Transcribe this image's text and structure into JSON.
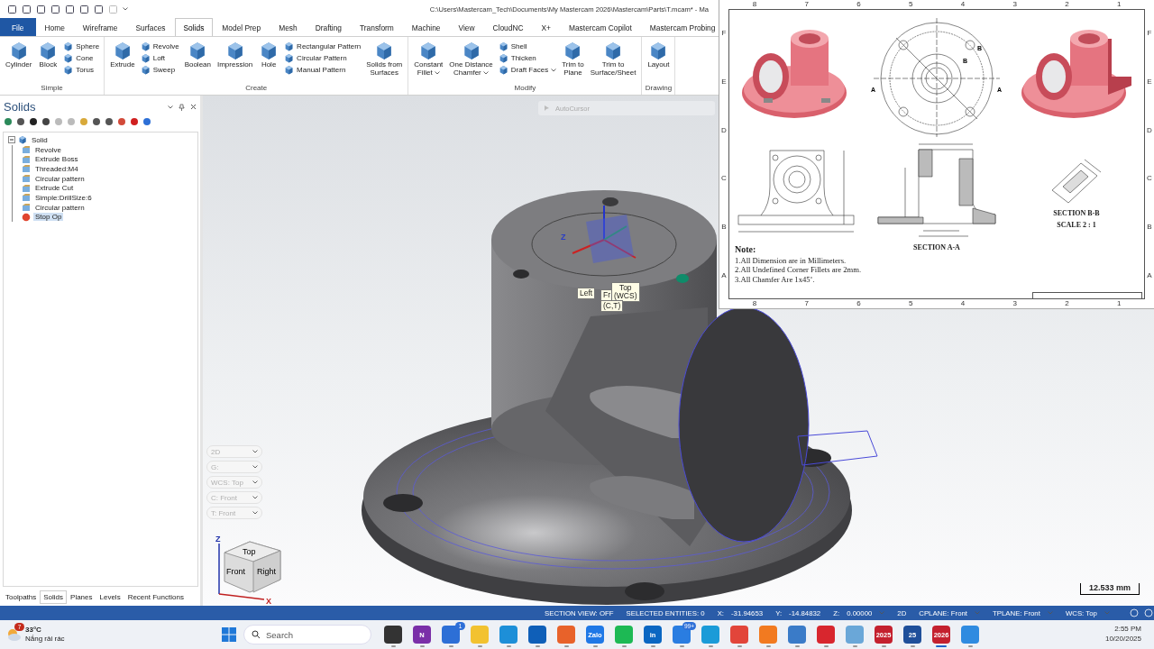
{
  "title_bar": {
    "path": "C:\\Users\\Mastercam_Tech\\Documents\\My Mastercam 2026\\Mastercam\\Parts\\T.mcam* - Ma"
  },
  "ribbon_tabs": [
    {
      "label": "File",
      "kind": "file",
      "selected": false
    },
    {
      "label": "Home",
      "kind": "tab",
      "selected": false
    },
    {
      "label": "Wireframe",
      "kind": "tab",
      "selected": false
    },
    {
      "label": "Surfaces",
      "kind": "tab",
      "selected": false
    },
    {
      "label": "Solids",
      "kind": "tab",
      "selected": true
    },
    {
      "label": "Model Prep",
      "kind": "tab",
      "selected": false
    },
    {
      "label": "Mesh",
      "kind": "tab",
      "selected": false
    },
    {
      "label": "Drafting",
      "kind": "tab",
      "selected": false
    },
    {
      "label": "Transform",
      "kind": "tab",
      "selected": false
    },
    {
      "label": "Machine",
      "kind": "tab",
      "selected": false
    },
    {
      "label": "View",
      "kind": "tab",
      "selected": false
    },
    {
      "label": "CloudNC",
      "kind": "tab",
      "selected": false
    },
    {
      "label": "X+",
      "kind": "tab",
      "selected": false
    },
    {
      "label": "Mastercam Copilot",
      "kind": "tab",
      "selected": false
    },
    {
      "label": "Mastercam Probing",
      "kind": "tab",
      "selected": false
    }
  ],
  "ribbon_groups": [
    {
      "label": "Simple",
      "items": [
        {
          "label": "Cylinder",
          "kind": "large",
          "dropdown": false
        },
        {
          "label": "Block",
          "kind": "large",
          "dropdown": false
        },
        {
          "label": "Sphere",
          "kind": "small",
          "dropdown": false
        },
        {
          "label": "Cone",
          "kind": "small",
          "dropdown": false
        },
        {
          "label": "Torus",
          "kind": "small",
          "dropdown": false
        }
      ]
    },
    {
      "label": "Create",
      "items": [
        {
          "label": "Extrude",
          "kind": "large",
          "dropdown": false
        },
        {
          "label": "Revolve",
          "kind": "small",
          "dropdown": false
        },
        {
          "label": "Loft",
          "kind": "small",
          "dropdown": false
        },
        {
          "label": "Sweep",
          "kind": "small",
          "dropdown": false
        },
        {
          "label": "Boolean",
          "kind": "large",
          "dropdown": false
        },
        {
          "label": "Impression",
          "kind": "large",
          "dropdown": false
        },
        {
          "label": "Hole",
          "kind": "large",
          "dropdown": false
        },
        {
          "label": "Rectangular Pattern",
          "kind": "small",
          "dropdown": false
        },
        {
          "label": "Circular Pattern",
          "kind": "small",
          "dropdown": false
        },
        {
          "label": "Manual Pattern",
          "kind": "small",
          "dropdown": false
        },
        {
          "label": "Solids from\nSurfaces",
          "kind": "large",
          "dropdown": false
        }
      ]
    },
    {
      "label": "Modify",
      "items": [
        {
          "label": "Constant\nFillet",
          "kind": "large",
          "dropdown": true
        },
        {
          "label": "One Distance\nChamfer",
          "kind": "large",
          "dropdown": true
        },
        {
          "label": "Shell",
          "kind": "small",
          "dropdown": false
        },
        {
          "label": "Thicken",
          "kind": "small",
          "dropdown": false
        },
        {
          "label": "Draft Faces",
          "kind": "small",
          "dropdown": true
        },
        {
          "label": "Trim to\nPlane",
          "kind": "large",
          "dropdown": false
        },
        {
          "label": "Trim to\nSurface/Sheet",
          "kind": "large",
          "dropdown": false
        }
      ]
    },
    {
      "label": "Drawing",
      "items": [
        {
          "label": "Layout",
          "kind": "large",
          "dropdown": false
        }
      ]
    }
  ],
  "solids_panel": {
    "title": "Solids",
    "tree": [
      {
        "label": "Solid",
        "expanded": true,
        "selected": false,
        "children": [
          {
            "label": "Revolve",
            "selected": false
          },
          {
            "label": "Extrude Boss",
            "selected": false
          },
          {
            "label": "Threaded:M4",
            "selected": false
          },
          {
            "label": "Circular pattern",
            "selected": false
          },
          {
            "label": "Extrude Cut",
            "selected": false
          },
          {
            "label": "Simple:DrillSize:6",
            "selected": false
          },
          {
            "label": "Circular pattern",
            "selected": false
          },
          {
            "label": "Stop Op",
            "selected": true
          }
        ]
      }
    ],
    "bottom_tabs": [
      {
        "label": "Toolpaths",
        "selected": false
      },
      {
        "label": "Solids",
        "selected": true
      },
      {
        "label": "Planes",
        "selected": false
      },
      {
        "label": "Levels",
        "selected": false
      },
      {
        "label": "Recent Functions",
        "selected": false
      }
    ]
  },
  "viewport": {
    "autocursor": "AutoCursor",
    "gnomon_label": "Z",
    "tooltips": [
      "Left",
      "Fr",
      "Top\n(WCS)",
      "(C,T)"
    ],
    "plane_controls": [
      {
        "label": "2D"
      },
      {
        "label": "G:"
      },
      {
        "label": "WCS: Top"
      },
      {
        "label": "C: Front"
      },
      {
        "label": "T: Front"
      }
    ],
    "view_cube": {
      "faces": [
        "Top",
        "Front",
        "Right"
      ],
      "axes": [
        "Z",
        "X"
      ]
    },
    "scale": "12.533 mm"
  },
  "drawing_sheet": {
    "top_numbers": [
      "8",
      "7",
      "6",
      "5",
      "4",
      "3",
      "2",
      "1"
    ],
    "bottom_numbers": [
      "8",
      "7",
      "6",
      "5",
      "4",
      "3",
      "2",
      "1"
    ],
    "left_letters": [
      "F",
      "E",
      "D",
      "C",
      "B",
      "A"
    ],
    "right_letters": [
      "F",
      "E",
      "D",
      "C",
      "B",
      "A"
    ],
    "top_view_labels": [
      "B",
      "B",
      "A",
      "A"
    ],
    "section_a_caption": "SECTION A-A",
    "section_b_caption": [
      "SECTION B-B",
      "SCALE 2 : 1"
    ],
    "note_title": "Note:",
    "notes": [
      "1.All Dimension are in Millimeters.",
      "2.All Undefined Corner Fillets are 2mm.",
      "3.All Chamfer Are 1x45˚."
    ]
  },
  "status_bar": [
    {
      "label": "SECTION VIEW: OFF",
      "dropdown": false
    },
    {
      "label": "SELECTED ENTITIES: 0",
      "dropdown": false
    },
    {
      "label": "X:",
      "value": "-31.94653",
      "dropdown": false
    },
    {
      "label": "Y:",
      "value": "-14.84832",
      "dropdown": false
    },
    {
      "label": "Z:",
      "value": "0.00000",
      "dropdown": true
    },
    {
      "label": "2D",
      "dropdown": false
    },
    {
      "label": "CPLANE: Front",
      "dropdown": true
    },
    {
      "label": "TPLANE: Front",
      "dropdown": true
    },
    {
      "label": "WCS: Top",
      "dropdown": true
    }
  ],
  "taskbar": {
    "weather": {
      "temperature": "33°C",
      "description": "Nắng rải rác",
      "badge": "7"
    },
    "search_placeholder": "Search",
    "apps": [
      {
        "color": "#333333",
        "selected": false
      },
      {
        "color": "#7a2fa8",
        "caption": "N",
        "selected": false
      },
      {
        "color": "#2d6fd6",
        "badge": "1",
        "selected": false
      },
      {
        "color": "#f2c230",
        "selected": false
      },
      {
        "color": "#1d8fd8",
        "selected": false
      },
      {
        "color": "#0f5fb8",
        "selected": false
      },
      {
        "color": "#e8622a",
        "selected": false
      },
      {
        "color": "#1f78e6",
        "caption": "Zalo",
        "selected": false
      },
      {
        "color": "#1db954",
        "selected": false
      },
      {
        "color": "#0a66c2",
        "caption": "in",
        "selected": false
      },
      {
        "color": "#2a7de1",
        "badge": "99+",
        "selected": false
      },
      {
        "color": "#1b9bd8",
        "selected": false
      },
      {
        "color": "#e2453a",
        "selected": false
      },
      {
        "color": "#f27a20",
        "selected": false
      },
      {
        "color": "#3a7bc8",
        "selected": false
      },
      {
        "color": "#d8262e",
        "selected": false
      },
      {
        "color": "#6aa7d8",
        "selected": false
      },
      {
        "color": "#c4202e",
        "caption": "2025",
        "selected": false
      },
      {
        "color": "#1f4f9a",
        "caption": "25",
        "selected": false
      },
      {
        "color": "#c4202e",
        "caption": "2026",
        "selected": true
      },
      {
        "color": "#2f8be0",
        "selected": false
      }
    ],
    "time": "2:55 PM",
    "date": "10/20/2025"
  }
}
